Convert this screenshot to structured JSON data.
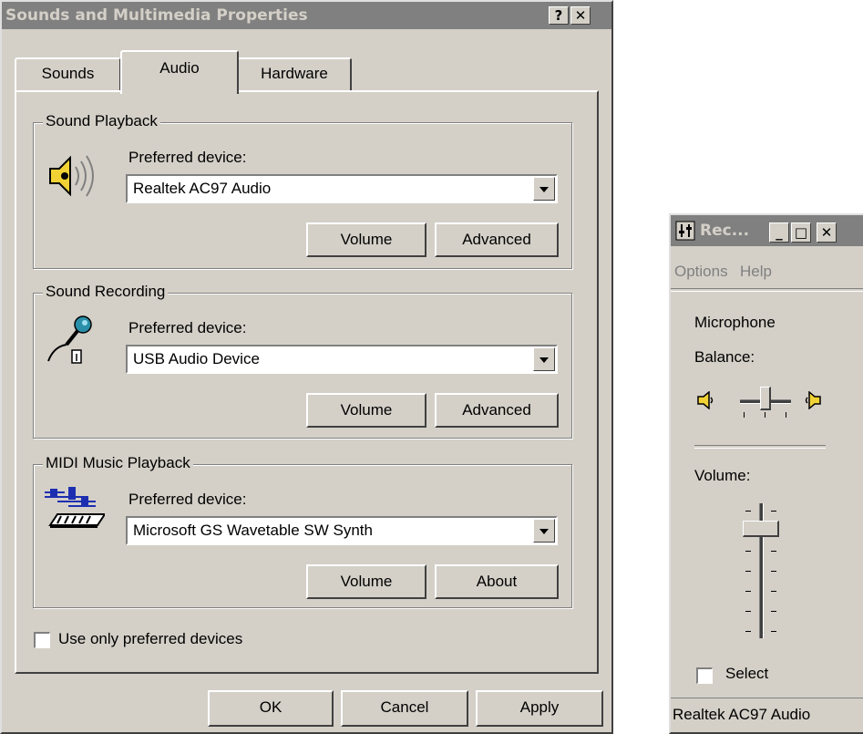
{
  "dialog": {
    "title": "Sounds and Multimedia Properties",
    "help_btn": "?",
    "close_btn": "✕",
    "tabs": [
      {
        "label": "Sounds"
      },
      {
        "label": "Audio"
      },
      {
        "label": "Hardware"
      }
    ],
    "active_tab": "Audio",
    "playback": {
      "group_label": "Sound Playback",
      "preferred_label": "Preferred device:",
      "device": "Realtek AC97 Audio",
      "volume_btn": "Volume",
      "advanced_btn": "Advanced",
      "icon": "speaker-icon"
    },
    "recording": {
      "group_label": "Sound Recording",
      "preferred_label": "Preferred device:",
      "device": "USB Audio Device",
      "volume_btn": "Volume",
      "advanced_btn": "Advanced",
      "icon": "microphone-icon"
    },
    "midi": {
      "group_label": "MIDI Music Playback",
      "preferred_label": "Preferred device:",
      "device": "Microsoft GS Wavetable SW Synth",
      "volume_btn": "Volume",
      "about_btn": "About",
      "icon": "midi-keyboard-icon"
    },
    "preferred_only": {
      "label": "Use only preferred devices",
      "checked": false
    },
    "ok_btn": "OK",
    "cancel_btn": "Cancel",
    "apply_btn": "Apply"
  },
  "recorder": {
    "title": "Rec...",
    "menu": [
      {
        "label": "Options"
      },
      {
        "label": "Help"
      }
    ],
    "channel": "Microphone",
    "balance_label": "Balance:",
    "volume_label": "Volume:",
    "balance_level": 0.5,
    "volume_level": 0.83,
    "select": {
      "label": "Select",
      "checked": false
    },
    "status": "Realtek AC97 Audio",
    "icons": [
      "mixer-app-icon",
      "left-speaker-icon",
      "right-speaker-icon"
    ],
    "caption_buttons": [
      "minimize",
      "maximize",
      "close"
    ]
  },
  "colors": {
    "face": "#d4d0c8",
    "inactive_title": "#808080",
    "shadow": "#404040"
  }
}
